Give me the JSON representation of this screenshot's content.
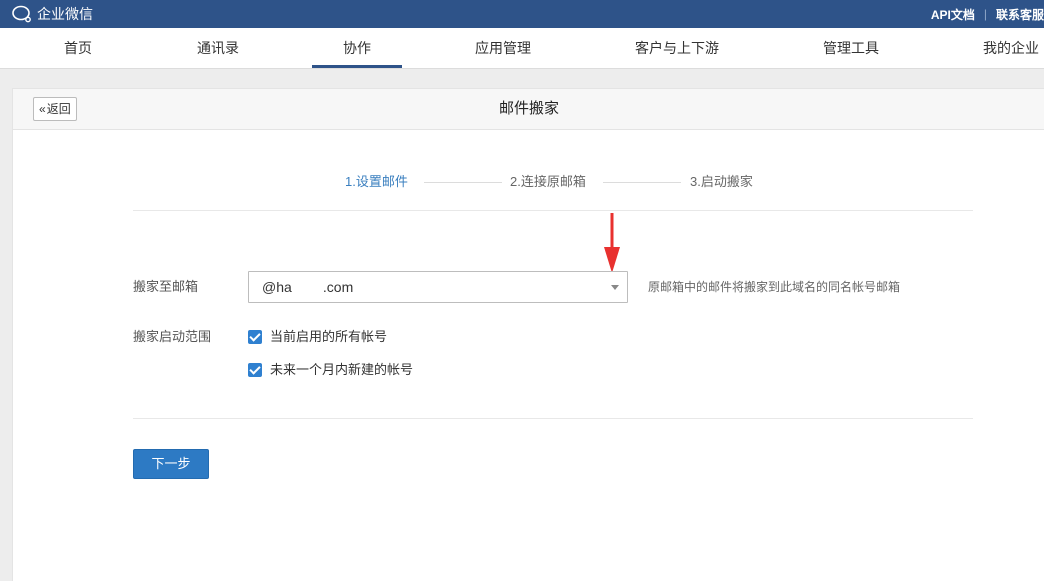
{
  "topbar": {
    "brand": "企业微信",
    "links": [
      "API文档",
      "联系客服"
    ]
  },
  "nav": {
    "items": [
      "首页",
      "通讯录",
      "协作",
      "应用管理",
      "客户与上下游",
      "管理工具",
      "我的企业"
    ],
    "active": "协作"
  },
  "page": {
    "back_label": "返回",
    "title": "邮件搬家",
    "steps": [
      "1.设置邮件",
      "2.连接原邮箱",
      "3.启动搬家"
    ]
  },
  "form": {
    "mailbox_label": "搬家至邮箱",
    "mailbox_value": "@ha        .com",
    "mailbox_hint": "原邮箱中的邮件将搬家到此域名的同名帐号邮箱",
    "scope_label": "搬家启动范围",
    "option_current": "当前启用的所有帐号",
    "option_future": "未来一个月内新建的帐号",
    "next_label": "下一步"
  },
  "colors": {
    "topbar": "#2e5389",
    "accent": "#3a7fbf",
    "button": "#2d7ac4",
    "annotation_arrow": "#e8312f"
  }
}
